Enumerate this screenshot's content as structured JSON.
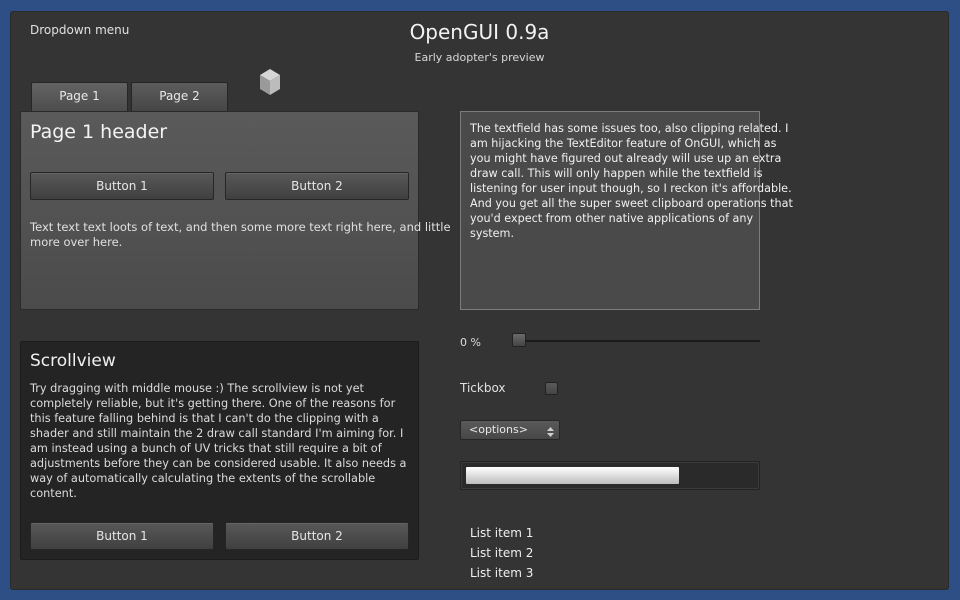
{
  "header": {
    "dropdown_menu": "Dropdown menu",
    "title": "OpenGUI 0.9a",
    "subtitle": "Early adopter's preview"
  },
  "tabs": [
    {
      "label": "Page 1",
      "active": true
    },
    {
      "label": "Page 2",
      "active": false
    }
  ],
  "icons": {
    "cube": "cube-icon",
    "select_arrow": "up-down-arrow-icon"
  },
  "page1": {
    "header": "Page 1 header",
    "button1": "Button 1",
    "button2": "Button 2",
    "text": "Text text text loots of text, and then some more text right here, and little more over here."
  },
  "scrollview": {
    "header": "Scrollview",
    "text": "Try dragging with middle mouse :) The scrollview is not yet completely reliable, but it's getting there. One of the reasons for this feature falling behind is that I can't do the clipping with a shader and still maintain the 2 draw call standard I'm aiming for. I am instead using a bunch of UV tricks that still require a bit of adjustments before they can be considered usable. It also needs a way of automatically calculating the extents of the scrollable content.",
    "button1": "Button 1",
    "button2": "Button 2"
  },
  "textfield": {
    "text": "The textfield has some issues too, also clipping related. I am hijacking the TextEditor feature of OnGUI, which as you might have figured out already will use up an extra draw call. This will only happen while the textfield is listening for user input though, so I reckon it's affordable. And you get all the super sweet clipboard operations that you'd expect from other native applications of any system."
  },
  "slider": {
    "label": "0 %",
    "value_percent": 0
  },
  "tickbox": {
    "label": "Tickbox",
    "checked": false
  },
  "select": {
    "value": "<options>"
  },
  "progress": {
    "fraction": 0.74
  },
  "list": [
    "List item 1",
    "List item 2",
    "List item 3"
  ],
  "colors": {
    "background": "#2d4f86",
    "window": "#343434",
    "panel": "#525252",
    "scrollview": "#242424"
  }
}
